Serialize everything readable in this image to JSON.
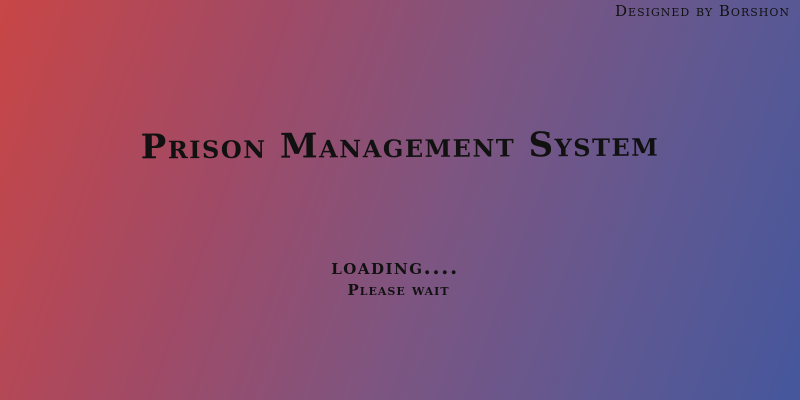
{
  "window": {
    "credit": "Designed by Borshon"
  },
  "splash": {
    "title": "Prison Management System",
    "loading_label": "loading....",
    "wait_label": "Please wait"
  },
  "colors": {
    "gradient_left": "#c84646",
    "gradient_right": "#45579c",
    "text": "#111111"
  }
}
